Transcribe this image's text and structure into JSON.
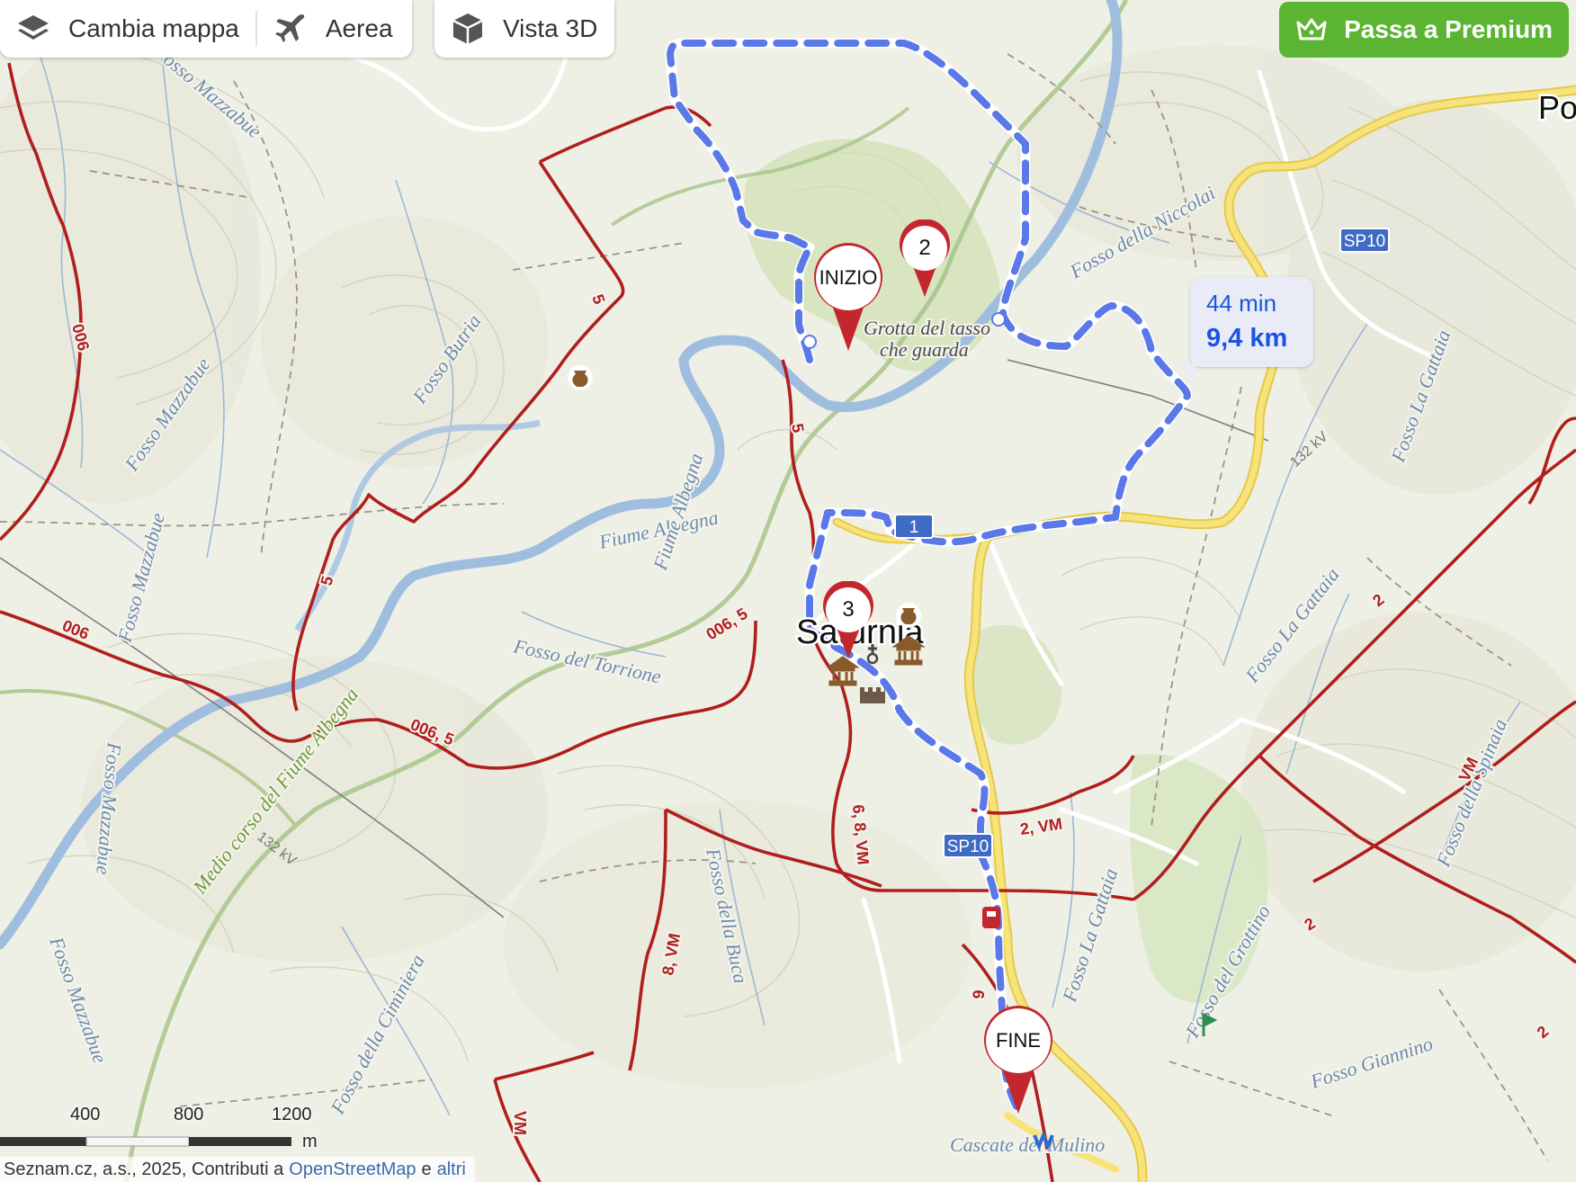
{
  "controls": {
    "change_map": "Cambia mappa",
    "aerial": "Aerea",
    "view_3d": "Vista 3D",
    "premium": "Passa a Premium"
  },
  "route": {
    "duration": "44 min",
    "distance": "9,4 km"
  },
  "markers": {
    "start": "INIZIO",
    "end": "FINE",
    "waypoint_2": "2",
    "waypoint_3": "3"
  },
  "labels": {
    "town_saturnia": "Saturnia",
    "town_po": "Po",
    "grotta_line1": "Grotta del tasso",
    "grotta_line2": "che guarda",
    "cascate": "Cascate del Mulino",
    "fiume_albegna_1": "Fiume Albegna",
    "fiume_albegna_2": "Fiume Albegna",
    "medio_corso": "Medio corso del Fiume Albegna",
    "fosso_mazzabue_1": "Fosso Mazzabue",
    "fosso_mazzabue_2": "Fosso Mazzabue",
    "fosso_mazzabue_3": "Fosso Mazzabue",
    "fosso_mazzabue_4": "Fosso Mazzabue",
    "fosso_mazzabue_5": "Fosso Mazzabue",
    "fosso_butria": "Fosso Butria",
    "fosso_torrione": "Fosso del Torrione",
    "fosso_niccolai": "Fosso della Niccolai",
    "fosso_gattaia_1": "Fosso La Gattaia",
    "fosso_gattaia_2": "Fosso La Gattaia",
    "fosso_gattaia_3": "Fosso La Gattaia",
    "fosso_spinaia": "Fosso della Spinaia",
    "fosso_buca": "Fosso della Buca",
    "fosso_ciminiera": "Fosso della Ciminiera",
    "fosso_grottino": "Fosso del Grottino",
    "fosso_giannino": "Fosso Giannino",
    "road_sp10_1": "SP10",
    "road_sp10_2": "SP10",
    "road_1": "1",
    "power_1": "132 kV",
    "power_2": "132 kV"
  },
  "trail_numbers": {
    "t5a": "5",
    "t5b": "5",
    "t5c": "5",
    "t006a": "006",
    "t006b": "006",
    "t006_5a": "006, 5",
    "t006_5b": "006, 5",
    "t68vm": "6, 8, VM",
    "t8vm": "8, VM",
    "t2vm": "2, VM",
    "t2a": "2",
    "t2b": "2",
    "t2c": "2",
    "tvm1": "VM",
    "tvm2": "VM",
    "tvm3": "VM",
    "t6": "6"
  },
  "scale": {
    "s400": "400",
    "s800": "800",
    "s1200": "1200",
    "unit": "m"
  },
  "attribution": {
    "text": "Seznam.cz, a.s., 2025, Contributi a",
    "osm": "OpenStreetMap",
    "e": "e",
    "others": "altri"
  },
  "colors": {
    "route": "#5b78e8",
    "trail": "#b01e1e",
    "marker": "#c4262e",
    "premium": "#5cb532",
    "accent_text": "#1a55e0"
  }
}
